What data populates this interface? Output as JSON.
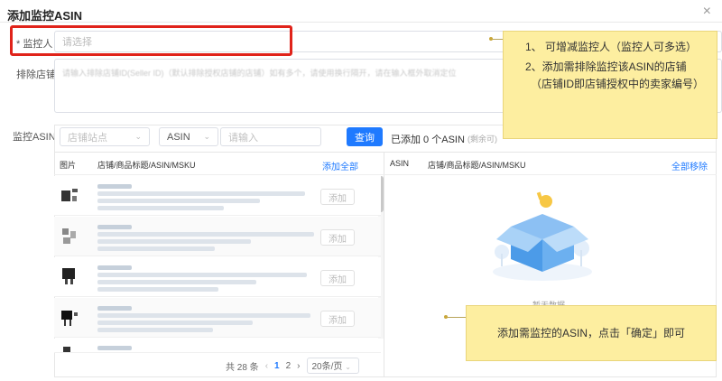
{
  "dialog": {
    "title": "添加监控ASIN",
    "close_icon": "×"
  },
  "form": {
    "monitor_label": "* 监控人",
    "monitor_placeholder": "请选择",
    "exclude_label": "排除店铺",
    "exclude_placeholder": "请输入排除店铺ID(Seller ID)（默认排除授权店铺的店铺）如有多个，请使用换行隔开，请在输入框外取消定位",
    "asin_label": "监控ASIN"
  },
  "notes": {
    "top_line1": "1、 可增减监控人（监控人可多选）",
    "top_line2": "2、添加需排除监控该ASIN的店铺",
    "top_line3": "（店铺ID即店铺授权中的卖家编号）",
    "bottom": "添加需监控的ASIN，点击「确定」即可"
  },
  "toolbar": {
    "shop_select_placeholder": "店铺站点",
    "asin_select": "ASIN",
    "search_placeholder": "请输入",
    "search_button": "查询",
    "added_text": "已添加 0 个ASIN",
    "remaining_text": "(剩余可)"
  },
  "left_table": {
    "col_image": "图片",
    "col_info": "店铺/商品标题/ASIN/MSKU",
    "add_all": "添加全部",
    "row_button": "添加",
    "rows": [
      {
        "id": 1
      },
      {
        "id": 2
      },
      {
        "id": 3
      },
      {
        "id": 4
      },
      {
        "id": 5
      }
    ]
  },
  "right_table": {
    "col_asin": "ASIN",
    "col_info": "店铺/商品标题/ASIN/MSKU",
    "remove_all": "全部移除",
    "empty_text": "暂无数据"
  },
  "pagination": {
    "total": "共 28 条",
    "prev_icon": "‹",
    "page1": "1",
    "page2": "2",
    "next_icon": "›",
    "page_size": "20条/页"
  },
  "colors": {
    "accent": "#1f7aff",
    "highlight_border": "#e0231a",
    "note_bg": "#fdeea0"
  }
}
